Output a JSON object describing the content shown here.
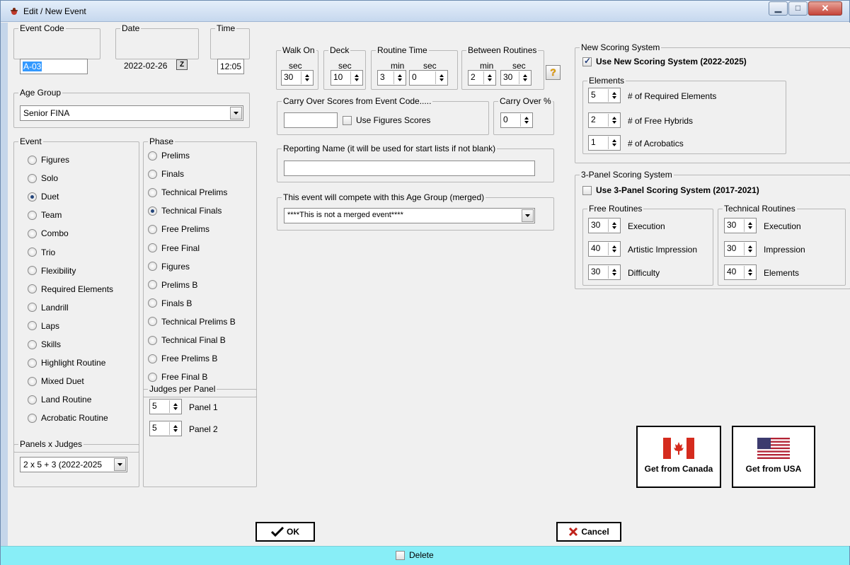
{
  "window": {
    "title": "Edit / New Event",
    "min_label": "▁",
    "max_label": "□",
    "close_label": "✕"
  },
  "event_code": {
    "legend": "Event Code",
    "value": "A-03"
  },
  "date": {
    "legend": "Date",
    "value": "2022-02-26",
    "btn_label": "Z"
  },
  "time": {
    "legend": "Time",
    "value": "12:05"
  },
  "age_group": {
    "legend": "Age Group",
    "value": "Senior FINA"
  },
  "event": {
    "legend": "Event",
    "selected": "Duet",
    "options": [
      "Figures",
      "Solo",
      "Duet",
      "Team",
      "Combo",
      "Trio",
      "Flexibility",
      "Required Elements",
      "Landrill",
      "Laps",
      "Skills",
      "Highlight Routine",
      "Mixed Duet",
      "Land Routine",
      "Acrobatic Routine"
    ]
  },
  "phase": {
    "legend": "Phase",
    "selected": "Technical Finals",
    "options": [
      "Prelims",
      "Finals",
      "Technical Prelims",
      "Technical Finals",
      "Free Prelims",
      "Free Final",
      "Figures",
      "Prelims B",
      "Finals B",
      "Technical Prelims B",
      "Technical Final B",
      "Free Prelims B",
      "Free Final B"
    ]
  },
  "judges_per_panel": {
    "legend": "Judges per Panel",
    "panel1_value": "5",
    "panel1_label": "Panel 1",
    "panel2_value": "5",
    "panel2_label": "Panel 2"
  },
  "panels_x_judges": {
    "legend": "Panels x Judges",
    "value": "2 x 5 + 3 (2022-2025"
  },
  "walk_on": {
    "legend": "Walk On",
    "unit": "sec",
    "value": "30"
  },
  "deck": {
    "legend": "Deck",
    "unit": "sec",
    "value": "10"
  },
  "routine_time": {
    "legend": "Routine Time",
    "min_label": "min",
    "sec_label": "sec",
    "min_value": "3",
    "sec_value": "0"
  },
  "between_routines": {
    "legend": "Between Routines",
    "min_label": "min",
    "sec_label": "sec",
    "min_value": "2",
    "sec_value": "30"
  },
  "help_label": "?",
  "carry_over": {
    "legend": "Carry Over Scores from Event Code.....",
    "code_value": "",
    "figures_label": "Use Figures Scores",
    "figures_checked": false
  },
  "carry_over_pct": {
    "legend": "Carry Over %",
    "value": "0"
  },
  "reporting_name": {
    "legend": "Reporting Name (it will be used for start lists if not blank)",
    "value": ""
  },
  "merged": {
    "legend": "This event will compete with this Age Group (merged)",
    "value": "****This is not a merged event****"
  },
  "new_scoring": {
    "legend": "New Scoring System",
    "checkbox_label": "Use New Scoring System (2022-2025)",
    "checked": true,
    "elements_legend": "Elements",
    "required_value": "5",
    "required_label": "# of Required Elements",
    "hybrids_value": "2",
    "hybrids_label": "# of Free Hybrids",
    "acro_value": "1",
    "acro_label": "# of Acrobatics"
  },
  "three_panel": {
    "legend": "3-Panel Scoring System",
    "checkbox_label": "Use 3-Panel Scoring System (2017-2021)",
    "checked": false,
    "free_legend": "Free Routines",
    "free": [
      {
        "value": "30",
        "label": "Execution"
      },
      {
        "value": "40",
        "label": "Artistic Impression"
      },
      {
        "value": "30",
        "label": "Difficulty"
      }
    ],
    "tech_legend": "Technical Routines",
    "tech": [
      {
        "value": "30",
        "label": "Execution"
      },
      {
        "value": "30",
        "label": "Impression"
      },
      {
        "value": "40",
        "label": "Elements"
      }
    ]
  },
  "get_canada_label": "Get from Canada",
  "get_usa_label": "Get from USA",
  "ok_label": "OK",
  "cancel_label": "Cancel",
  "delete_label": "Delete",
  "colors": {
    "status_bar": "#88eef7",
    "title_bar": "#c6d8ee",
    "accent": "#243e7a"
  }
}
